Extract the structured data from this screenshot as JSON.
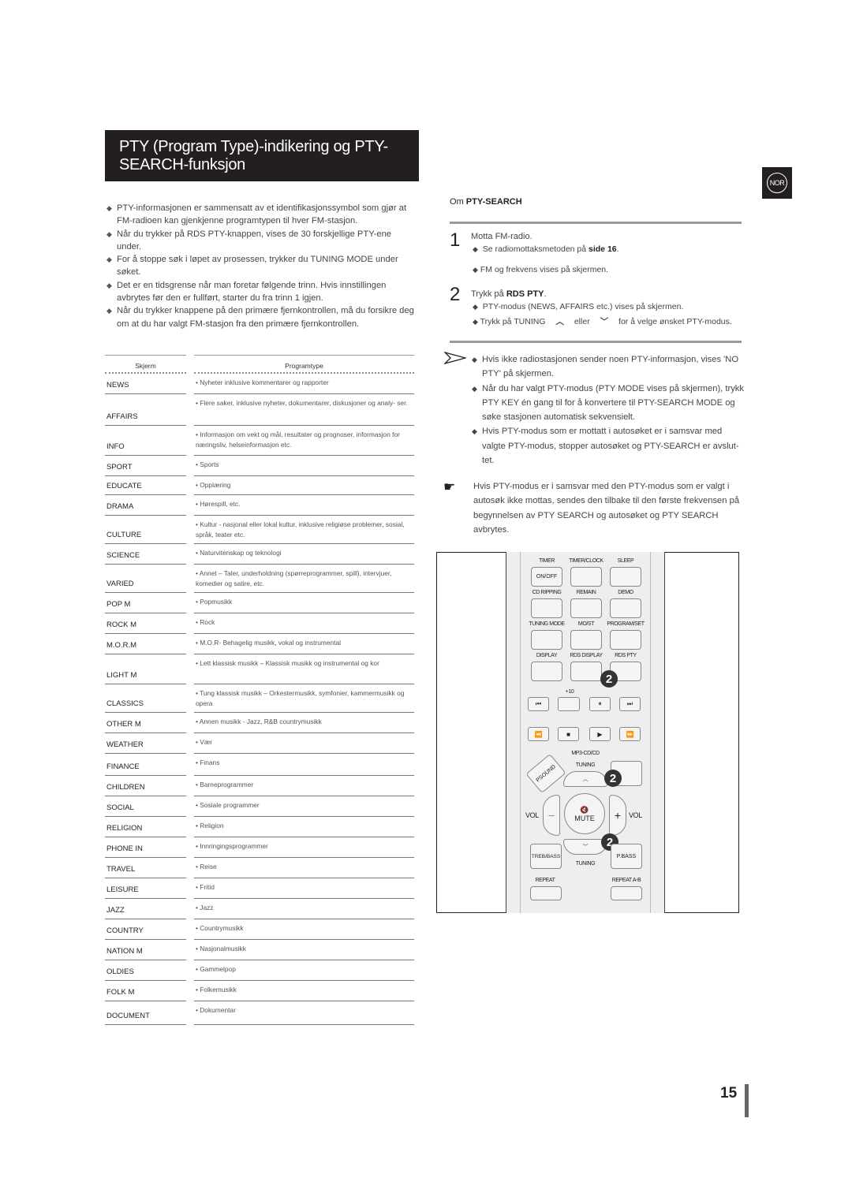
{
  "header": {
    "title_line1": "PTY (Program Type)-indikering og PTY-",
    "title_line2": "SEARCH-funksjon",
    "language_badge": "NOR"
  },
  "intro_bullets": [
    "PTY-informasjonen er sammensatt av et identifikasjonssymbol som gjør at FM-radioen kan gjenkjenne programtypen til hver FM-stasjon.",
    "Når du trykker på RDS PTY-knappen, vises de 30 forskjellige PTY-ene under.",
    "For å stoppe søk i løpet av prosessen, trykker du TUNING MODE under søket.",
    "Det er en tidsgrense når man foretar følgende trinn. Hvis innstillingen avbrytes før den er fullført, starter du fra trinn 1 igjen.",
    "Når du trykker knappene på den primære fjernkontrollen, må du forsikre deg om at du har valgt FM-stasjon fra den primære fjernkontrollen."
  ],
  "table": {
    "headers": [
      "Skjerm",
      "Programtype"
    ],
    "rows": [
      {
        "code": "NEWS",
        "desc": "• Nyheter inklusive kommentarer og rapporter"
      },
      {
        "code": "AFFAIRS",
        "desc": "• Flere saker, inklusive nyheter, dokumentarer, diskusjoner og analy- ser."
      },
      {
        "code": "INFO",
        "desc": "• Informasjon om vekt og mål, resultater og prognoser, informasjon for næringsliv, helseinformasjon etc."
      },
      {
        "code": "SPORT",
        "desc": "• Sports"
      },
      {
        "code": "EDUCATE",
        "desc": "• Opplæring"
      },
      {
        "code": "DRAMA",
        "desc": "• Hørespill, etc."
      },
      {
        "code": "CULTURE",
        "desc": "• Kultur - nasjonal eller lokal kultur, inklusive religiøse problemer, sosial, språk, teater etc."
      },
      {
        "code": "SCIENCE",
        "desc": "• Naturvitenskap og teknologi"
      },
      {
        "code": "VARIED",
        "desc": "• Annet – Taler, underholdning (spørreprogrammer, spill), intervjuer, komedier og satire, etc."
      },
      {
        "code": "POP M",
        "desc": "• Popmusikk"
      },
      {
        "code": "ROCK M",
        "desc": "• Rock"
      },
      {
        "code": "M.O.R.M",
        "desc": "• M.O.R- Behagelig musikk, vokal og instrumental"
      },
      {
        "code": "LIGHT M",
        "desc": "• Lett klassisk musikk – Klassisk musikk og instrumental og kor"
      },
      {
        "code": "CLASSICS",
        "desc": "• Tung klassisk musikk – Orkestermusikk, symfonier, kammermusikk og opera"
      },
      {
        "code": "OTHER M",
        "desc": "• Annen musikk - Jazz, R&B countrymusikk"
      },
      {
        "code": "WEATHER",
        "desc": "• Vær"
      },
      {
        "code": "FINANCE",
        "desc": "• Finans"
      },
      {
        "code": "CHILDREN",
        "desc": "• Barneprogrammer"
      },
      {
        "code": "SOCIAL",
        "desc": "• Sosiale programmer"
      },
      {
        "code": "RELIGION",
        "desc": "• Religion"
      },
      {
        "code": "PHONE IN",
        "desc": "• Innringingsprogrammer"
      },
      {
        "code": "TRAVEL",
        "desc": "• Reise"
      },
      {
        "code": "LEISURE",
        "desc": "• Fritid"
      },
      {
        "code": "JAZZ",
        "desc": "• Jazz"
      },
      {
        "code": "COUNTRY",
        "desc": "• Countrymusikk"
      },
      {
        "code": "NATION M",
        "desc": "• Nasjonalmusikk"
      },
      {
        "code": "OLDIES",
        "desc": "• Gammelpop"
      },
      {
        "code": "FOLK M",
        "desc": "• Folkemusikk"
      },
      {
        "code": "DOCUMENT",
        "desc": "• Dokumentar"
      }
    ]
  },
  "pty_search": {
    "heading_prefix": "Om ",
    "heading_bold": "PTY-SEARCH",
    "steps": [
      {
        "number": "1",
        "text": "Motta FM-radio.",
        "sub": [
          {
            "text": "Se radiomottaksmetoden på ",
            "bold": "side 16",
            "suffix": "."
          },
          {
            "text": "FM og frekvens vises på skjermen.",
            "bold": "",
            "suffix": ""
          }
        ]
      },
      {
        "number": "2",
        "text_prefix": "Trykk på ",
        "text_bold": "RDS PTY",
        "text_suffix": ".",
        "sub": [
          {
            "text": "PTY-modus (NEWS, AFFAIRS etc.) vises på skjermen."
          },
          {
            "text_prefix": "Trykk på TUNING",
            "middle": "eller",
            "text_suffix": "for å velge ønsket PTY-modus."
          }
        ]
      }
    ],
    "notes": [
      "Hvis ikke radiostasjonen sender noen PTY-informasjon, vises 'NO PTY' på skjermen.",
      "Når du har valgt PTY-modus (PTY MODE vises på skjermen), trykk PTY KEY én gang til for å konvertere til PTY-SEARCH MODE og søke stasjonen automatisk sekvensielt.",
      "Hvis PTY-modus som er mottatt i autosøket er i samsvar med valgte PTY-modus, stopper autosøket og PTY-SEARCH er avslut- tet."
    ],
    "hand_note": "Hvis PTY-modus er i samsvar med den PTY-modus som er valgt i autosøk ikke mottas, sendes den tilbake til den første frekvensen på begynnelsen av  PTY SEARCH og autosøket og PTY SEARCH avbrytes."
  },
  "remote": {
    "row_labels": [
      [
        "TIMER",
        "TIMER/CLOCK",
        "SLEEP"
      ],
      [
        "CD RIPPING",
        "REMAIN",
        "DEMO"
      ],
      [
        "TUNING MODE",
        "MO/ST",
        "PROGRAM/SET"
      ],
      [
        "DISPLAY",
        "RDS DISPLAY",
        "RDS PTY"
      ]
    ],
    "on_off": "ON/OFF",
    "plus10": "+10",
    "transport1": [
      "⏮",
      "",
      "⏸",
      "⏭"
    ],
    "transport2": [
      "⏪",
      "■",
      "▶",
      "⏩"
    ],
    "mp3_label": "MP3-CD/CD",
    "psound": "PSOUND",
    "tuning_up": "TUNING",
    "tuning_down": "TUNING",
    "vol_left": "VOL",
    "vol_right": "VOL",
    "mute": "MUTE",
    "treb": "TREB/BASS",
    "pbass": "P.BASS",
    "repeat": "REPEAT",
    "repeat_ab": "REPEAT A-B",
    "callout": "2"
  },
  "footer": {
    "page_number": "15"
  }
}
